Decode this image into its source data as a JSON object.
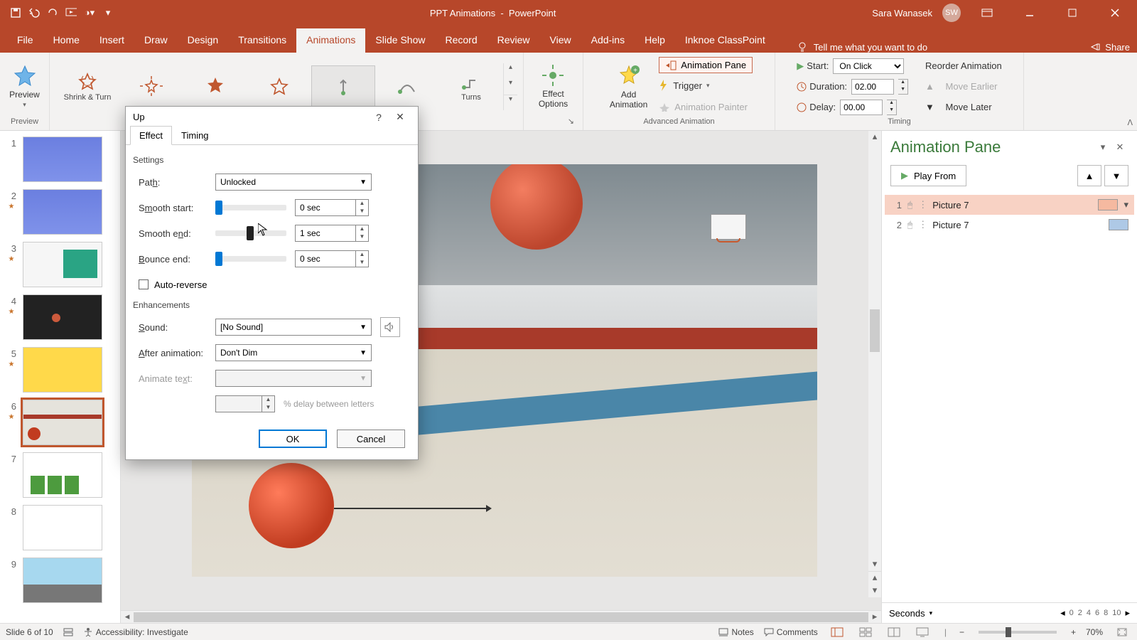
{
  "titlebar": {
    "document": "PPT Animations",
    "app": "PowerPoint",
    "user_name": "Sara Wanasek",
    "user_initials": "SW"
  },
  "tabs": {
    "file": "File",
    "list": [
      "Home",
      "Insert",
      "Draw",
      "Design",
      "Transitions",
      "Animations",
      "Slide Show",
      "Record",
      "Review",
      "View",
      "Add-ins",
      "Help",
      "Inknoe ClassPoint"
    ],
    "active": "Animations",
    "tell_me": "Tell me what you want to do",
    "share": "Share"
  },
  "ribbon": {
    "preview": "Preview",
    "preview_group": "Preview",
    "gallery": [
      "Shrink & Turn",
      "",
      "",
      "",
      "",
      "",
      "Turns"
    ],
    "effect_options": "Effect\nOptions",
    "add_animation": "Add\nAnimation",
    "animation_pane": "Animation Pane",
    "trigger": "Trigger",
    "painter": "Animation Painter",
    "adv_group": "Advanced Animation",
    "start_label": "Start:",
    "start_value": "On Click",
    "duration_label": "Duration:",
    "duration_value": "02.00",
    "delay_label": "Delay:",
    "delay_value": "00.00",
    "reorder": "Reorder Animation",
    "move_earlier": "Move Earlier",
    "move_later": "Move Later",
    "timing_group": "Timing"
  },
  "dialog": {
    "title": "Up",
    "tab_effect": "Effect",
    "tab_timing": "Timing",
    "settings_label": "Settings",
    "path_label": "Path:",
    "path_value": "Unlocked",
    "smooth_start_label": "Smooth start:",
    "smooth_start_value": "0 sec",
    "smooth_end_label": "Smooth end:",
    "smooth_end_value": "1 sec",
    "bounce_label": "Bounce end:",
    "bounce_value": "0 sec",
    "auto_reverse": "Auto-reverse",
    "enhancements_label": "Enhancements",
    "sound_label": "Sound:",
    "sound_value": "[No Sound]",
    "after_label": "After animation:",
    "after_value": "Don't Dim",
    "animate_text_label": "Animate text:",
    "delay_letters": "% delay between letters",
    "ok": "OK",
    "cancel": "Cancel"
  },
  "anim_pane": {
    "title": "Animation Pane",
    "play": "Play From",
    "items": [
      {
        "num": "1",
        "label": "Picture 7",
        "color": "#f5b9a0"
      },
      {
        "num": "2",
        "label": "Picture 7",
        "color": "#aec9e6"
      }
    ],
    "seconds": "Seconds",
    "ticks": [
      "0",
      "2",
      "4",
      "6",
      "8",
      "10"
    ]
  },
  "status": {
    "slide": "Slide 6 of 10",
    "accessibility": "Accessibility: Investigate",
    "notes": "Notes",
    "comments": "Comments",
    "zoom": "70%"
  },
  "thumbs": {
    "count": 9,
    "active": 6
  }
}
